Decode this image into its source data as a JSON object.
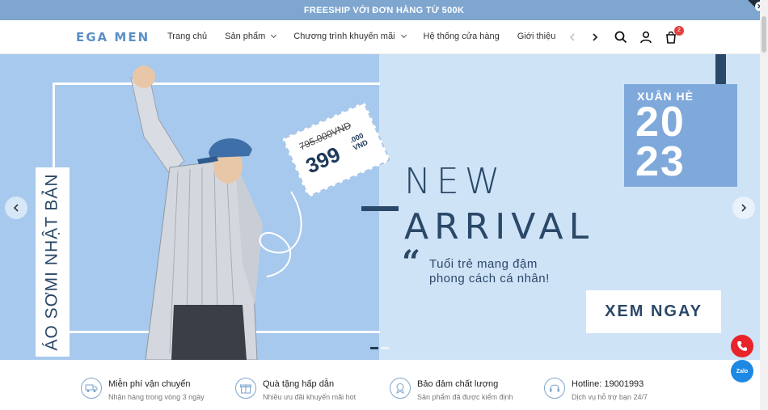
{
  "topbar": {
    "text": "FREESHIP VỚI ĐƠN HÀNG TỪ 500K"
  },
  "header": {
    "logo": "EGA MEN",
    "nav": [
      "Trang chủ",
      "Sản phẩm",
      "Chương trình khuyến mãi",
      "Hệ thống cửa hàng",
      "Giới thiệu"
    ],
    "cart_count": "2"
  },
  "hero": {
    "vertical_title": "ÁO SƠMI NHẬT BẢN",
    "price_old": "795.000VND",
    "price_new": "399",
    "price_new_unit_top": ".000",
    "price_new_unit_bottom": "VND",
    "headline1": "NEW",
    "headline2": "ARRIVAL",
    "slogan1": "Tuổi trẻ mang đậm",
    "slogan2": "phong cách cá nhân!",
    "season_label": "XUÂN HÈ",
    "season_year1": "20",
    "season_year2": "23",
    "cta": "XEM NGAY"
  },
  "features": [
    {
      "title": "Miễn phí vận chuyển",
      "sub": "Nhận hàng trong vòng 3 ngày",
      "icon": "truck-icon"
    },
    {
      "title": "Quà tặng hấp dẫn",
      "sub": "Nhiều ưu đãi khuyến mãi hot",
      "icon": "gift-icon"
    },
    {
      "title": "Bảo đảm chất lượng",
      "sub": "Sản phẩm đã được kiểm định",
      "icon": "badge-icon"
    },
    {
      "title": "Hotline: 19001993",
      "sub": "Dịch vụ hỗ trợ bạn 24/7",
      "icon": "headset-icon"
    }
  ],
  "float": {
    "zalo": "Zalo"
  },
  "colors": {
    "brand": "#7ea6cf",
    "navy": "#2a4868",
    "hero_left": "#a7c9ed",
    "hero_right": "#cfe3f7"
  }
}
